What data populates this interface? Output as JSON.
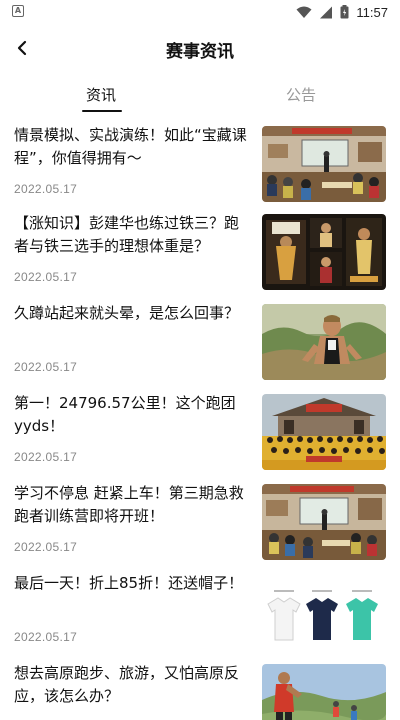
{
  "status_bar": {
    "time": "11:57",
    "icons": [
      "notification-a-icon",
      "wifi-icon",
      "signal-icon",
      "battery-icon"
    ]
  },
  "header": {
    "back_icon": "chevron-left-icon",
    "title": "赛事资讯"
  },
  "tabs": [
    {
      "label": "资讯",
      "active": true
    },
    {
      "label": "公告",
      "active": false
    }
  ],
  "news": [
    {
      "title": "情景模拟、实战演练！如此“宝藏课程”，你值得拥有～",
      "date": "2022.05.17",
      "thumbnail": "classroom-training-photo"
    },
    {
      "title": "【涨知识】彭建华也练过铁三？跑者与铁三选手的理想体重是？",
      "date": "2022.05.17",
      "thumbnail": "triathlete-collage-photo"
    },
    {
      "title": "久蹲站起来就头晕，是怎么回事？",
      "date": "2022.05.17",
      "thumbnail": "runner-outdoor-photo"
    },
    {
      "title": "第一！24796.57公里！这个跑团yyds！",
      "date": "2022.05.17",
      "thumbnail": "running-club-group-photo"
    },
    {
      "title": "学习不停息 赶紧上车！第三期急救跑者训练营即将开班！",
      "date": "2022.05.17",
      "thumbnail": "first-aid-class-photo"
    },
    {
      "title": "最后一天！折上85折！还送帽子！",
      "date": "2022.05.17",
      "thumbnail": "tshirt-products-photo"
    },
    {
      "title": "想去高原跑步、旅游，又怕高原反应，该怎么办？",
      "date": "",
      "thumbnail": "plateau-runners-photo"
    }
  ]
}
